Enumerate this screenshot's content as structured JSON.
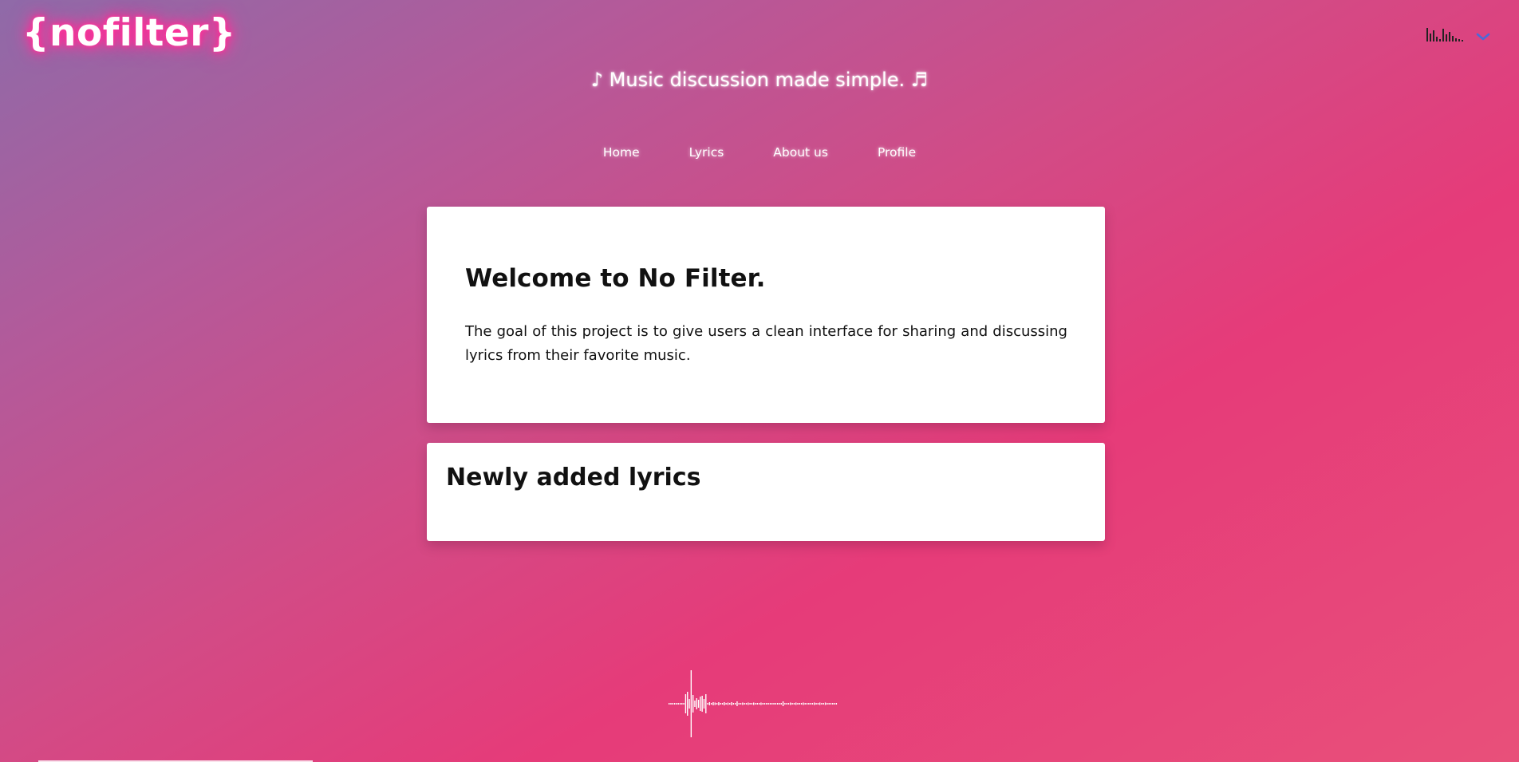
{
  "header": {
    "logo_text": "{nofilter}",
    "tagline": "♪ Music discussion made simple. ♬"
  },
  "controls": {
    "equalizer_icon": "equalizer-icon",
    "dropdown_icon": "chevron-down-icon",
    "chevron_color": "#4a6ad8"
  },
  "nav": {
    "items": [
      {
        "label": "Home"
      },
      {
        "label": "Lyrics"
      },
      {
        "label": "About us"
      },
      {
        "label": "Profile"
      }
    ]
  },
  "welcome": {
    "title": "Welcome to No Filter.",
    "body": "The goal of this project is to give users a clean interface for sharing and discussing lyrics from their favorite music."
  },
  "newly_added": {
    "title": "Newly added lyrics"
  },
  "colors": {
    "gradient_start": "#8f6aa8",
    "gradient_mid": "#d24b86",
    "gradient_end": "#e63b79",
    "logo_glow": "#ff2a94",
    "card_background": "#ffffff"
  }
}
